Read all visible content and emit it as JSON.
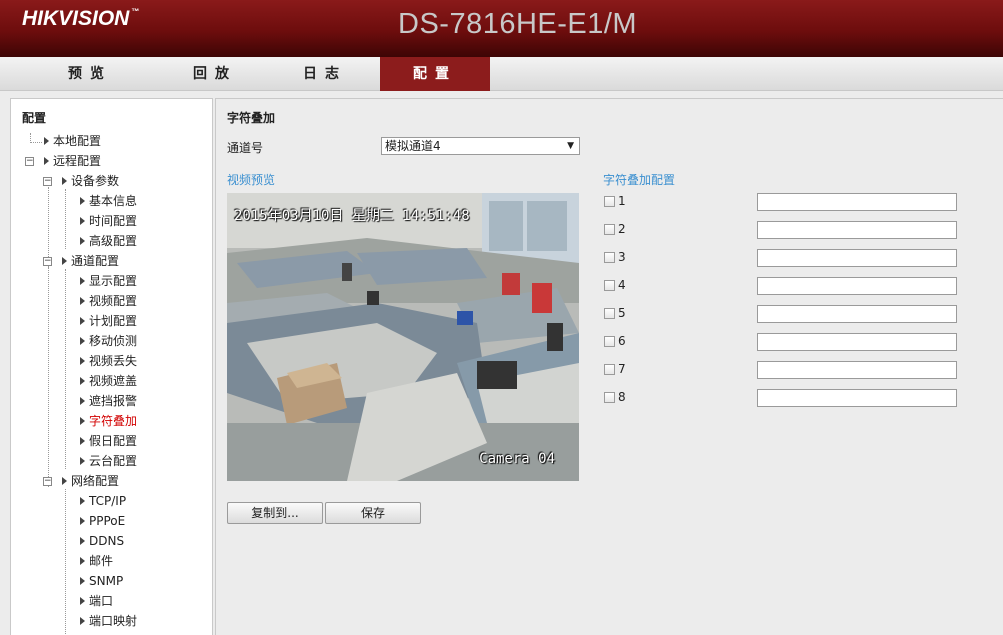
{
  "header": {
    "logo_text": "HIKVISION",
    "logo_tm": "™",
    "model": "DS-7816HE-E1/M"
  },
  "nav": {
    "tabs": [
      {
        "label": "预览"
      },
      {
        "label": "回放"
      },
      {
        "label": "日志"
      },
      {
        "label": "配置",
        "active": true
      }
    ]
  },
  "sidebar": {
    "title": "配置",
    "items": [
      {
        "label": "本地配置"
      },
      {
        "label": "远程配置"
      },
      {
        "label": "设备参数"
      },
      {
        "label": "基本信息"
      },
      {
        "label": "时间配置"
      },
      {
        "label": "高级配置"
      },
      {
        "label": "通道配置"
      },
      {
        "label": "显示配置"
      },
      {
        "label": "视频配置"
      },
      {
        "label": "计划配置"
      },
      {
        "label": "移动侦测"
      },
      {
        "label": "视频丢失"
      },
      {
        "label": "视频遮盖"
      },
      {
        "label": "遮挡报警"
      },
      {
        "label": "字符叠加",
        "active": true
      },
      {
        "label": "假日配置"
      },
      {
        "label": "云台配置"
      },
      {
        "label": "网络配置"
      },
      {
        "label": "TCP/IP"
      },
      {
        "label": "PPPoE"
      },
      {
        "label": "DDNS"
      },
      {
        "label": "邮件"
      },
      {
        "label": "SNMP"
      },
      {
        "label": "端口"
      },
      {
        "label": "端口映射"
      }
    ]
  },
  "main": {
    "title": "字符叠加",
    "channel_label": "通道号",
    "channel_value": "模拟通道4",
    "preview_label": "视频预览",
    "osd_config_label": "字符叠加配置",
    "osd_date": "2015年03月10日 星期二 14:51:48",
    "osd_camera": "Camera 04",
    "copy_button": "复制到...",
    "save_button": "保存",
    "osd_rows": [
      {
        "label": "1",
        "value": ""
      },
      {
        "label": "2",
        "value": ""
      },
      {
        "label": "3",
        "value": ""
      },
      {
        "label": "4",
        "value": ""
      },
      {
        "label": "5",
        "value": ""
      },
      {
        "label": "6",
        "value": ""
      },
      {
        "label": "7",
        "value": ""
      },
      {
        "label": "8",
        "value": ""
      }
    ]
  },
  "colors": {
    "brand_red": "#8c1c1c",
    "active_tree_item": "#d20000",
    "section_label": "#3a8fd0"
  }
}
